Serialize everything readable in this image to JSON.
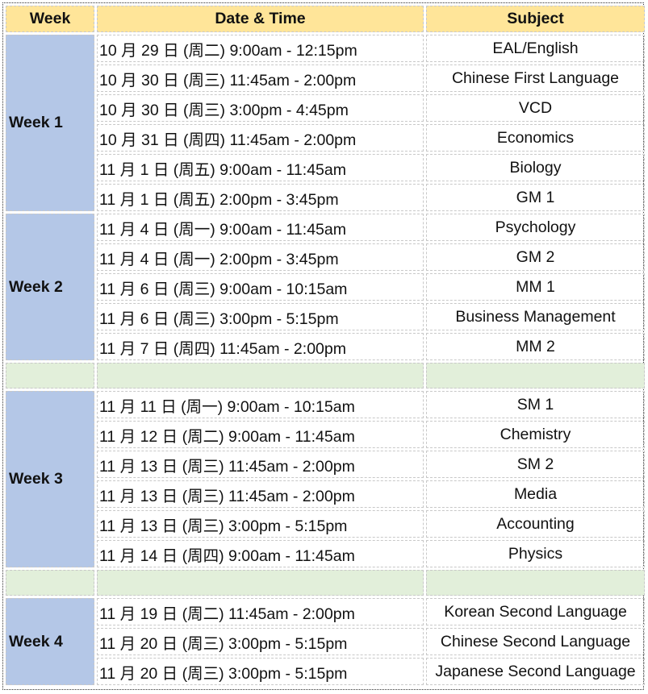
{
  "header": {
    "week": "Week",
    "date": "Date & Time",
    "subject": "Subject"
  },
  "colors": {
    "header_bg": "#ffe599",
    "week_bg": "#b4c7e7",
    "gap_bg": "#e2efda"
  },
  "weeks": [
    {
      "label": "Week 1",
      "rows": [
        {
          "date": "10 月 29 日 (周二) 9:00am - 12:15pm",
          "subject": "EAL/English"
        },
        {
          "date": "10 月 30 日 (周三) 11:45am - 2:00pm",
          "subject": "Chinese First Language"
        },
        {
          "date": "10 月 30 日 (周三) 3:00pm - 4:45pm",
          "subject": "VCD"
        },
        {
          "date": "10 月 31 日 (周四) 11:45am - 2:00pm",
          "subject": "Economics"
        },
        {
          "date": "11 月 1 日 (周五) 9:00am - 11:45am",
          "subject": "Biology"
        },
        {
          "date": "11 月 1 日 (周五) 2:00pm - 3:45pm",
          "subject": "GM 1"
        }
      ]
    },
    {
      "label": "Week 2",
      "rows": [
        {
          "date": "11 月 4 日 (周一) 9:00am - 11:45am",
          "subject": "Psychology"
        },
        {
          "date": "11 月 4 日 (周一) 2:00pm - 3:45pm",
          "subject": "GM 2"
        },
        {
          "date": "11 月 6 日 (周三) 9:00am - 10:15am",
          "subject": "MM 1"
        },
        {
          "date": "11 月 6 日 (周三) 3:00pm - 5:15pm",
          "subject": "Business Management"
        },
        {
          "date": "11 月 7 日 (周四) 11:45am - 2:00pm",
          "subject": "MM 2"
        }
      ],
      "gap_after": true
    },
    {
      "label": "Week 3",
      "rows": [
        {
          "date": "11 月 11 日 (周一) 9:00am - 10:15am",
          "subject": "SM 1"
        },
        {
          "date": "11 月 12 日 (周二) 9:00am - 11:45am",
          "subject": "Chemistry"
        },
        {
          "date": "11 月 13 日 (周三) 11:45am - 2:00pm",
          "subject": "SM 2"
        },
        {
          "date": "11 月 13 日 (周三) 11:45am - 2:00pm",
          "subject": "Media"
        },
        {
          "date": "11 月 13 日 (周三) 3:00pm - 5:15pm",
          "subject": "Accounting"
        },
        {
          "date": "11 月 14 日 (周四) 9:00am - 11:45am",
          "subject": "Physics"
        }
      ],
      "gap_after": true
    },
    {
      "label": "Week 4",
      "rows": [
        {
          "date": "11 月 19 日 (周二) 11:45am - 2:00pm",
          "subject": "Korean Second Language"
        },
        {
          "date": "11 月 20 日 (周三) 3:00pm - 5:15pm",
          "subject": "Chinese Second Language"
        },
        {
          "date": "11 月 20 日 (周三) 3:00pm - 5:15pm",
          "subject": "Japanese Second Language"
        }
      ]
    }
  ]
}
